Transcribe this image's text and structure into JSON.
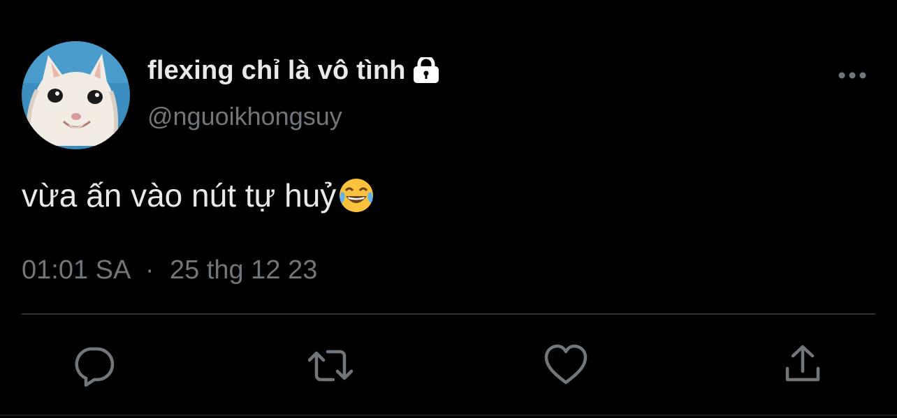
{
  "tweet": {
    "display_name": "flexing chỉ là vô tình",
    "handle": "@nguoikhongsuy",
    "text": "vừa ấn vào nút tự huỷ",
    "emoji": "face-with-tears-of-joy-icon",
    "time": "01:01 SA",
    "separator": "·",
    "date": "25 thg 12 23"
  },
  "icons": {
    "lock": "lock-icon",
    "more": "more-dots-icon",
    "reply": "reply-icon",
    "retweet": "retweet-icon",
    "like": "heart-icon",
    "share": "share-icon"
  },
  "colors": {
    "background": "#000000",
    "primary_text": "#e7e9ea",
    "secondary_text": "#71767b",
    "divider": "#2f3336",
    "avatar_bg": "#3a8fc0"
  }
}
